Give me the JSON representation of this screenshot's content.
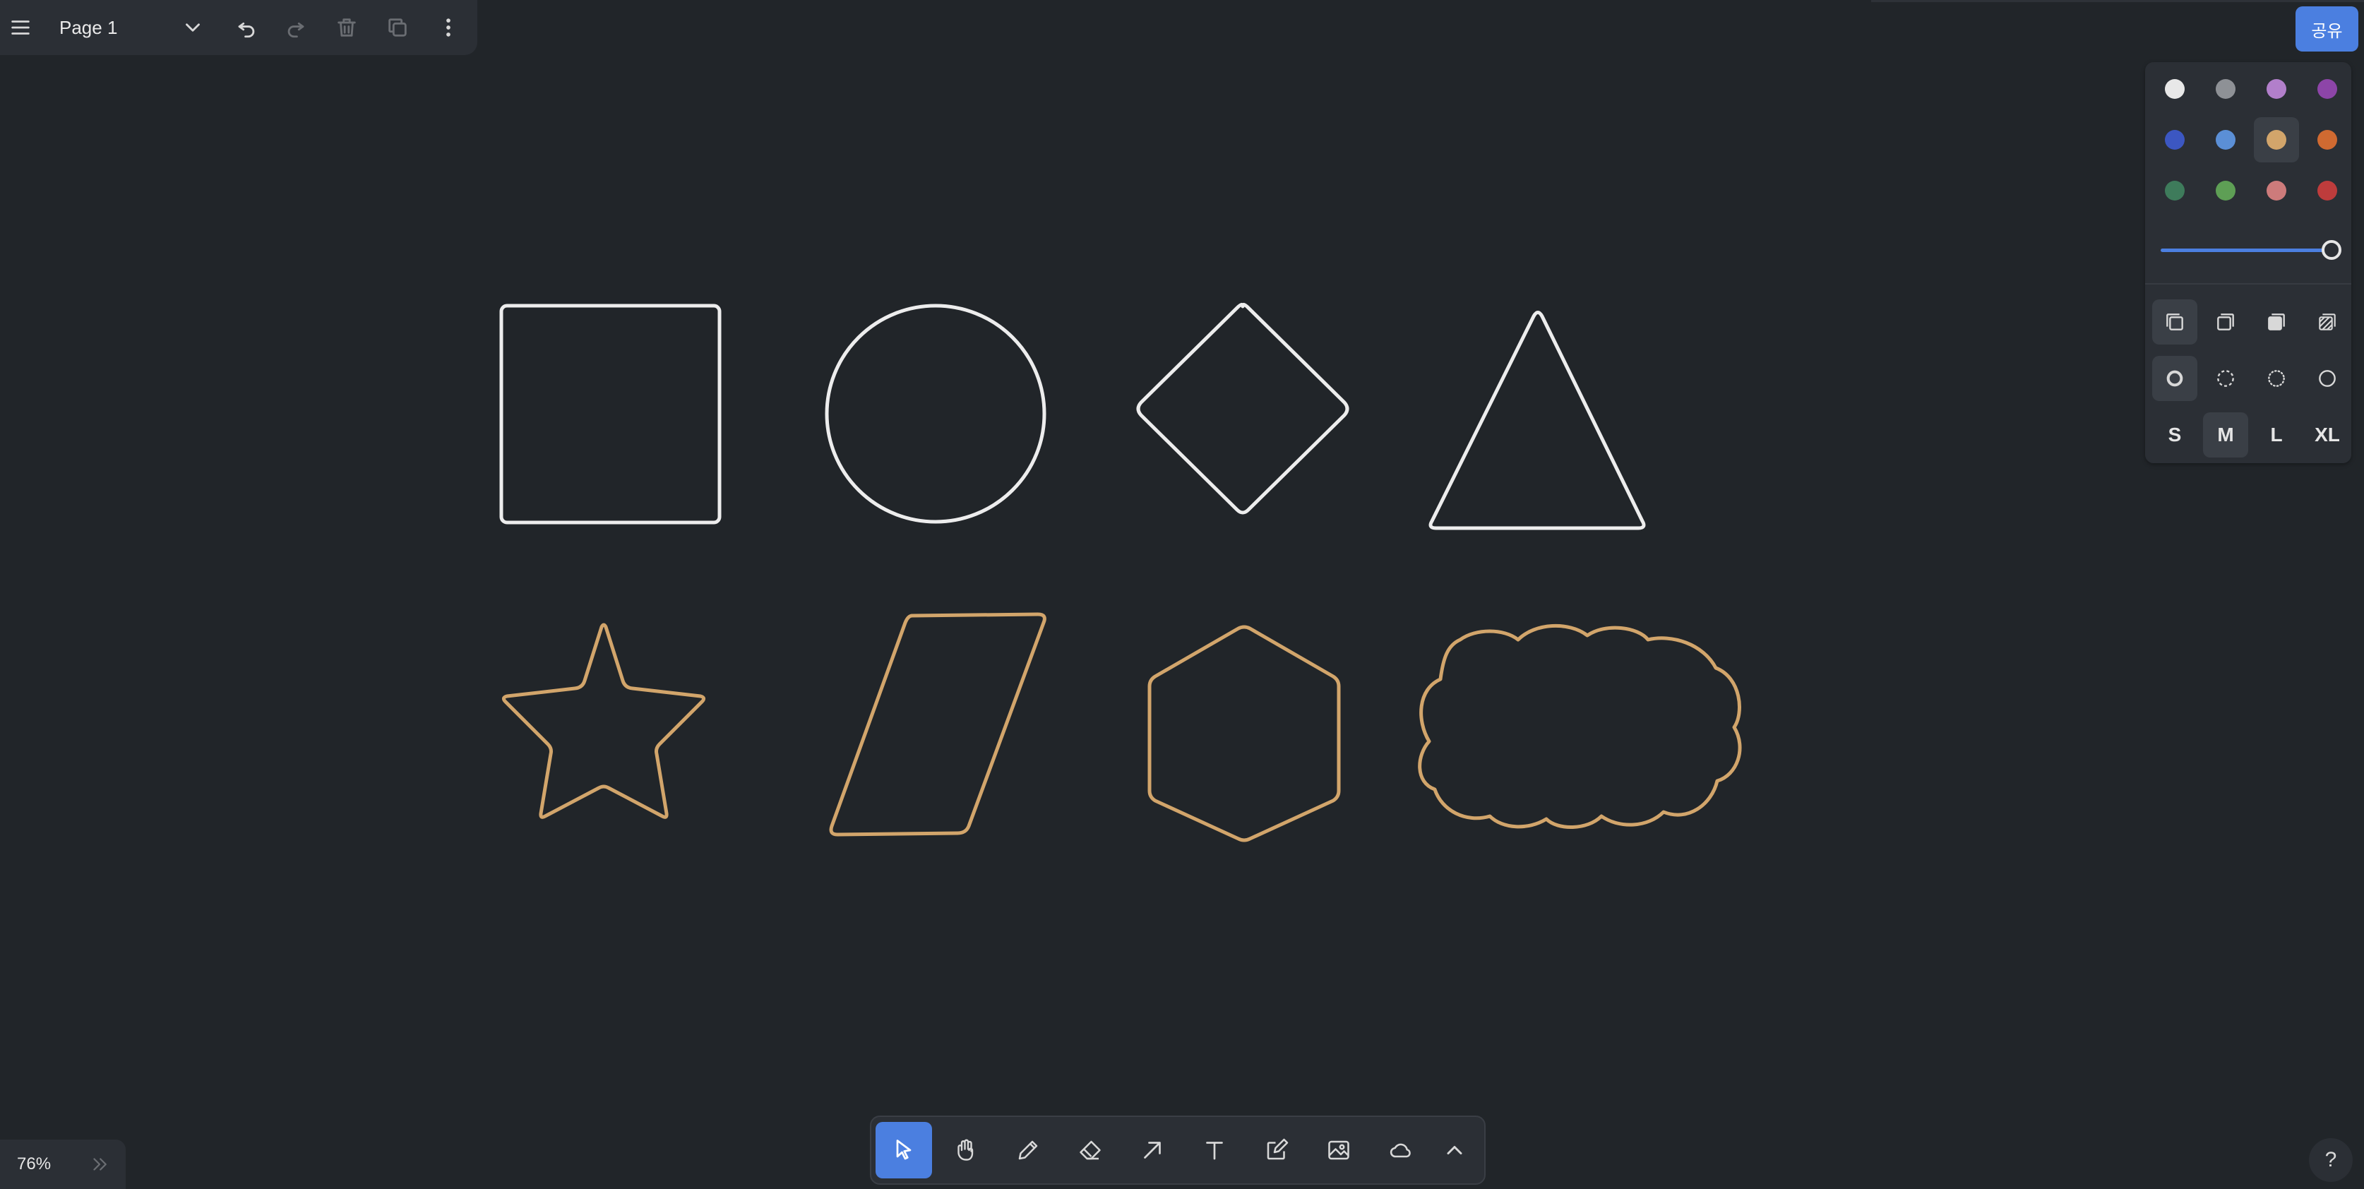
{
  "top_bar": {
    "page_name": "Page 1",
    "icons": [
      "menu-icon",
      "chevron-down-icon",
      "undo-icon",
      "redo-icon",
      "trash-icon",
      "duplicate-icon",
      "more-vertical-icon"
    ]
  },
  "share": {
    "label": "공유",
    "color": "#4b7fe0"
  },
  "style_panel": {
    "colors": [
      {
        "name": "white",
        "hex": "#e8e8e8"
      },
      {
        "name": "grey",
        "hex": "#8e9196"
      },
      {
        "name": "light-violet",
        "hex": "#b27fcb"
      },
      {
        "name": "violet",
        "hex": "#8d45a8"
      },
      {
        "name": "blue",
        "hex": "#3c57c2"
      },
      {
        "name": "light-blue",
        "hex": "#5b8fd6"
      },
      {
        "name": "yellow",
        "hex": "#d2a56b"
      },
      {
        "name": "orange",
        "hex": "#d06a31"
      },
      {
        "name": "green",
        "hex": "#3e7b5b"
      },
      {
        "name": "light-green",
        "hex": "#5e9f55"
      },
      {
        "name": "light-red",
        "hex": "#cd7b7b"
      },
      {
        "name": "red",
        "hex": "#be3c3c"
      }
    ],
    "selected_color": "yellow",
    "opacity": 1.0,
    "fill_options": [
      "fill-none-icon",
      "fill-semi-icon",
      "fill-solid-icon",
      "fill-pattern-icon"
    ],
    "selected_fill": "fill-none-icon",
    "dash_options": [
      "dash-draw-icon",
      "dash-dashed-icon",
      "dash-dotted-icon",
      "dash-solid-icon"
    ],
    "selected_dash": "dash-draw-icon",
    "sizes": [
      "S",
      "M",
      "L",
      "XL"
    ],
    "selected_size": "M"
  },
  "toolbar": {
    "tools": [
      "select-icon",
      "hand-icon",
      "draw-icon",
      "eraser-icon",
      "arrow-icon",
      "text-icon",
      "note-icon",
      "image-icon",
      "cloud-icon",
      "chevron-up-icon"
    ],
    "selected_tool": "select-icon"
  },
  "zoom": {
    "level": "76%"
  },
  "help": {
    "label": "?"
  },
  "canvas": {
    "shapes": [
      {
        "type": "rectangle",
        "stroke": "#ededed"
      },
      {
        "type": "ellipse",
        "stroke": "#ededed"
      },
      {
        "type": "diamond",
        "stroke": "#ededed"
      },
      {
        "type": "triangle",
        "stroke": "#ededed"
      },
      {
        "type": "star",
        "stroke": "#d2a56b"
      },
      {
        "type": "trapezoid",
        "stroke": "#d2a56b"
      },
      {
        "type": "hexagon",
        "stroke": "#d2a56b"
      },
      {
        "type": "cloud",
        "stroke": "#d2a56b"
      }
    ],
    "background": "#212529"
  }
}
